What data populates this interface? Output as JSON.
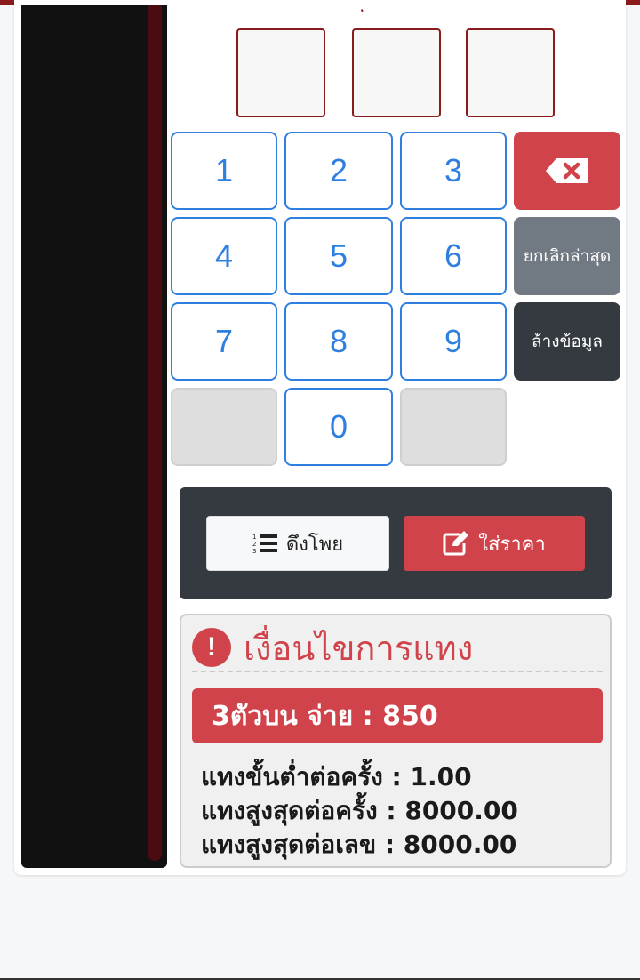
{
  "header": {
    "glyph": "ุ"
  },
  "digit_boxes": [
    "",
    "",
    ""
  ],
  "keypad": {
    "keys": [
      "1",
      "2",
      "3",
      "4",
      "5",
      "6",
      "7",
      "8",
      "9",
      "0"
    ]
  },
  "actions": {
    "backspace_icon": "backspace-icon",
    "undo_label": "ยกเลิกล่าสุด",
    "clear_label": "ล้างข้อมูล"
  },
  "buttons": {
    "pull_label": "ดึงโพย",
    "pull_icon": "list-icon",
    "price_label": "ใส่ราคา",
    "price_icon": "edit-icon"
  },
  "conditions": {
    "title": "เงื่อนไขการแทง",
    "icon": "exclamation-circle-icon",
    "rate": "3ตัวบน จ่าย : 850",
    "min_per_bet": "แทงขั้นต่ำต่อครั้ง : 1.00",
    "max_per_bet": "แทงสูงสุดต่อครั้ง : 8000.00",
    "max_per_number": "แทงสูงสุดต่อเลข : 8000.00"
  },
  "colors": {
    "accent_red": "#d0434a",
    "key_blue": "#2f7fe0",
    "dark": "#353a40",
    "gray": "#717982",
    "maroon": "#8b1a1a"
  }
}
